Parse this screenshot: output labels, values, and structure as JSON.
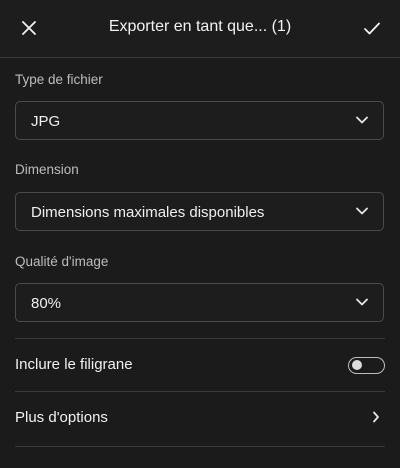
{
  "header": {
    "title": "Exporter en tant que... (1)",
    "close_icon": "close-icon",
    "confirm_icon": "checkmark-icon"
  },
  "file_type": {
    "label": "Type de fichier",
    "value": "JPG"
  },
  "dimension": {
    "label": "Dimension",
    "value": "Dimensions maximales disponibles"
  },
  "quality": {
    "label": "Qualité d'image",
    "value": "80%"
  },
  "watermark": {
    "label": "Inclure le filigrane",
    "enabled": false
  },
  "more_options": {
    "label": "Plus d'options",
    "icon": "chevron-right-icon"
  },
  "colors": {
    "background": "#1b1b1b",
    "border": "#4a4a4a",
    "text": "#f0f0f0",
    "muted_text": "#bdbdbd"
  }
}
